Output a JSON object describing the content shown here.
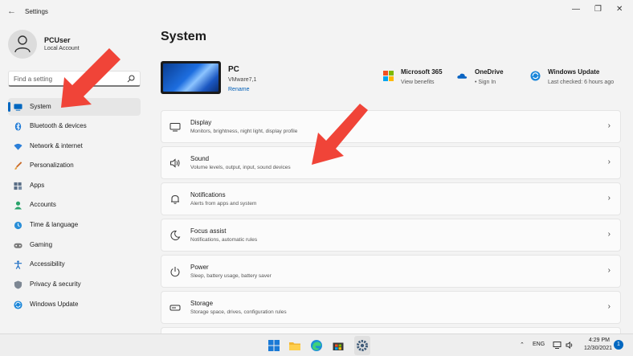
{
  "window": {
    "title": "Settings",
    "back_glyph": "←",
    "minimize_glyph": "—",
    "maximize_glyph": "❐",
    "close_glyph": "✕"
  },
  "profile": {
    "name": "PCUser",
    "account_type": "Local Account"
  },
  "search": {
    "placeholder": "Find a setting"
  },
  "sidebar": {
    "items": [
      {
        "label": "System",
        "icon": "monitor-icon",
        "selected": true
      },
      {
        "label": "Bluetooth & devices",
        "icon": "bluetooth-icon"
      },
      {
        "label": "Network & internet",
        "icon": "wifi-icon"
      },
      {
        "label": "Personalization",
        "icon": "brush-icon"
      },
      {
        "label": "Apps",
        "icon": "apps-icon"
      },
      {
        "label": "Accounts",
        "icon": "person-icon"
      },
      {
        "label": "Time & language",
        "icon": "globe-clock-icon"
      },
      {
        "label": "Gaming",
        "icon": "gamepad-icon"
      },
      {
        "label": "Accessibility",
        "icon": "accessibility-icon"
      },
      {
        "label": "Privacy & security",
        "icon": "shield-icon"
      },
      {
        "label": "Windows Update",
        "icon": "update-icon"
      }
    ]
  },
  "main": {
    "title": "System",
    "device": {
      "name": "PC",
      "model": "VMware7,1",
      "rename_label": "Rename"
    },
    "quick_links": [
      {
        "title": "Microsoft 365",
        "subtitle": "View benefits",
        "icon": "microsoft-logo-icon"
      },
      {
        "title": "OneDrive",
        "subtitle": "• Sign In",
        "icon": "cloud-icon"
      },
      {
        "title": "Windows Update",
        "subtitle": "Last checked: 6 hours ago",
        "icon": "update-icon"
      }
    ],
    "cards": [
      {
        "title": "Display",
        "subtitle": "Monitors, brightness, night light, display profile",
        "icon": "monitor-icon"
      },
      {
        "title": "Sound",
        "subtitle": "Volume levels, output, input, sound devices",
        "icon": "speaker-icon"
      },
      {
        "title": "Notifications",
        "subtitle": "Alerts from apps and system",
        "icon": "bell-icon"
      },
      {
        "title": "Focus assist",
        "subtitle": "Notifications, automatic rules",
        "icon": "moon-icon"
      },
      {
        "title": "Power",
        "subtitle": "Sleep, battery usage, battery saver",
        "icon": "power-icon"
      },
      {
        "title": "Storage",
        "subtitle": "Storage space, drives, configuration rules",
        "icon": "storage-icon"
      }
    ],
    "chevron_glyph": "›"
  },
  "taskbar": {
    "language": "ENG",
    "time": "4:29 PM",
    "date": "12/30/2021",
    "notification_count": "1"
  },
  "colors": {
    "accent": "#0067c0",
    "annotation_arrow": "#f04438"
  }
}
